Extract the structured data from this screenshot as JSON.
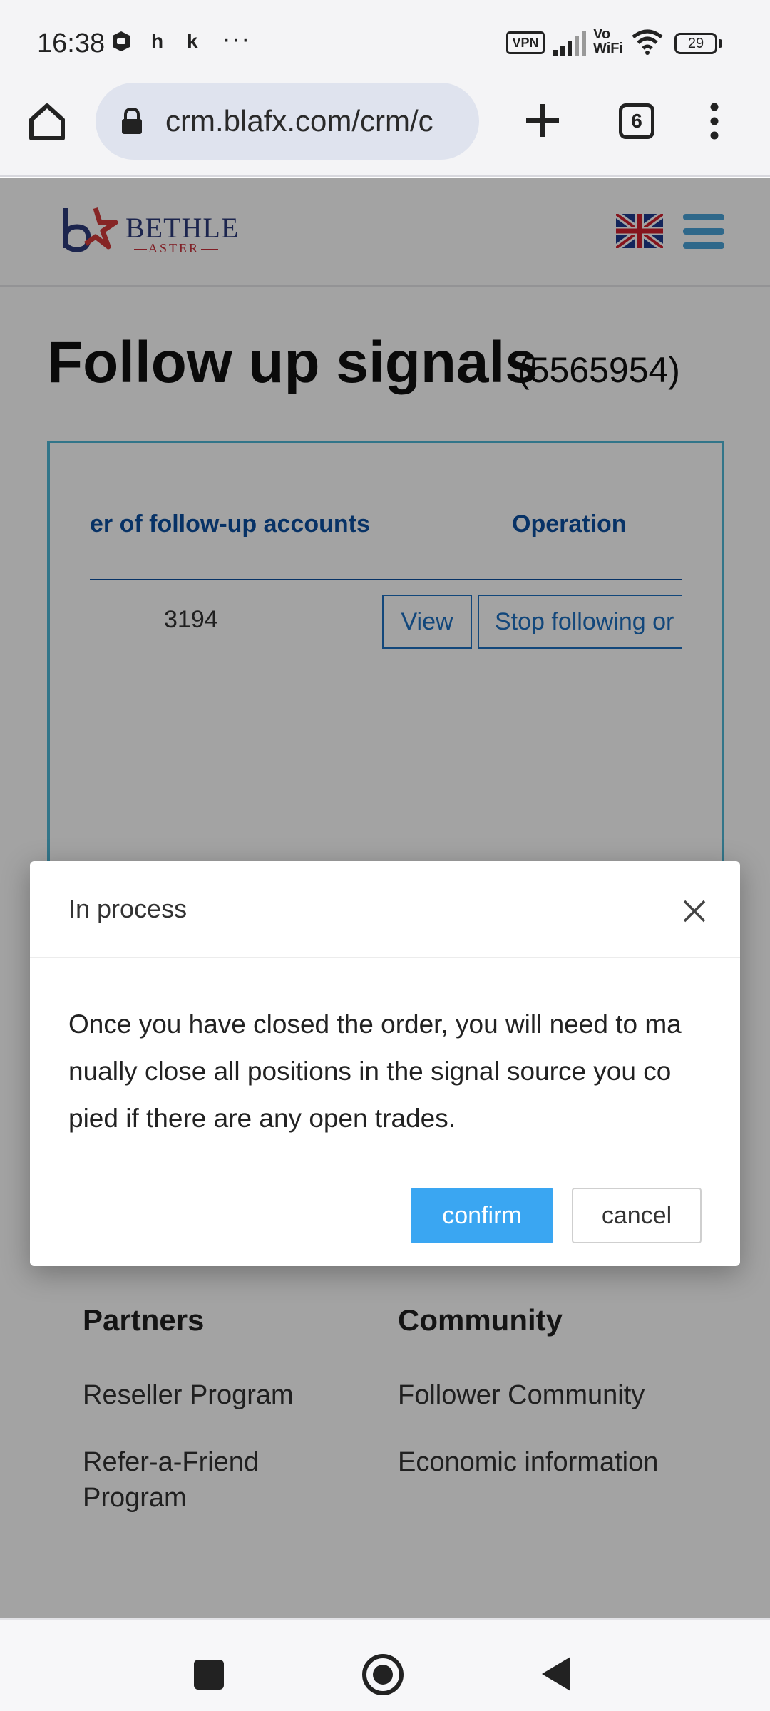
{
  "status_bar": {
    "time": "16:38",
    "notif_h": "h",
    "notif_k": "k",
    "more": "···",
    "vpn": "VPN",
    "vo": "Vo",
    "wifi_label": "WiFi",
    "battery": "29"
  },
  "browser": {
    "url": "crm.blafx.com/crm/c",
    "tab_count": "6"
  },
  "site": {
    "logo_main": "BETHLE",
    "logo_sub": "ASTER"
  },
  "page": {
    "title": "Follow up signals",
    "title_id": "(5565954)"
  },
  "table": {
    "headers": [
      "er of follow-up accounts",
      "Operation"
    ],
    "rows": [
      {
        "count": "3194",
        "view_label": "View",
        "stop_label": "Stop following or"
      }
    ]
  },
  "footer": {
    "partners": {
      "heading": "Partners",
      "links": [
        "Reseller Program",
        "Refer-a-Friend",
        "Program"
      ]
    },
    "community": {
      "heading": "Community",
      "links": [
        "Follower Community",
        "Economic information"
      ]
    }
  },
  "modal": {
    "title": "In process",
    "body_lines": [
      "Once you have closed the order, you will need to ma",
      "nually close all positions in the signal source you co",
      "pied if there are any open trades."
    ],
    "confirm_label": "confirm",
    "cancel_label": "cancel"
  },
  "colors": {
    "accent": "#3aa6f2",
    "table_border": "#4fb8d6",
    "header_blue": "#0b4fa0",
    "menu_blue": "#4aa3d8"
  }
}
